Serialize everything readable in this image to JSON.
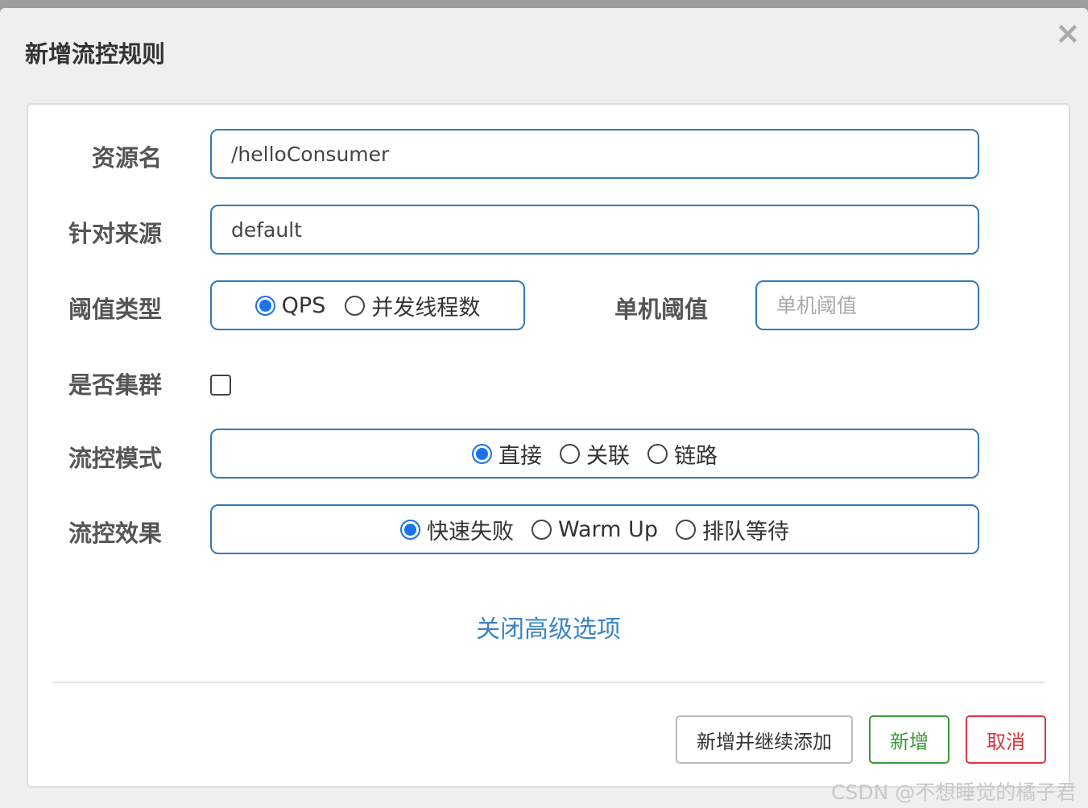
{
  "dialog": {
    "title": "新增流控规则",
    "close_symbol": "×"
  },
  "form": {
    "resource": {
      "label": "资源名",
      "value": "/helloConsumer"
    },
    "limit_app": {
      "label": "针对来源",
      "value": "default"
    },
    "grade": {
      "label": "阈值类型",
      "options": [
        {
          "label": "QPS",
          "checked": true
        },
        {
          "label": "并发线程数",
          "checked": false
        }
      ]
    },
    "threshold": {
      "label": "单机阈值",
      "placeholder": "单机阈值",
      "value": ""
    },
    "cluster": {
      "label": "是否集群",
      "checked": false
    },
    "strategy": {
      "label": "流控模式",
      "options": [
        {
          "label": "直接",
          "checked": true
        },
        {
          "label": "关联",
          "checked": false
        },
        {
          "label": "链路",
          "checked": false
        }
      ]
    },
    "control_behavior": {
      "label": "流控效果",
      "options": [
        {
          "label": "快速失败",
          "checked": true
        },
        {
          "label": "Warm Up",
          "checked": false
        },
        {
          "label": "排队等待",
          "checked": false
        }
      ]
    },
    "advanced_toggle": "关闭高级选项"
  },
  "footer": {
    "add_continue": "新增并继续添加",
    "add": "新增",
    "cancel": "取消"
  },
  "colors": {
    "primary_border": "#337ab7",
    "radio_checked": "#1a73e8",
    "link": "#3c84c6",
    "success": "#3a9a3a",
    "danger": "#d9363e"
  },
  "watermark": "CSDN @不想睡觉的橘子君"
}
